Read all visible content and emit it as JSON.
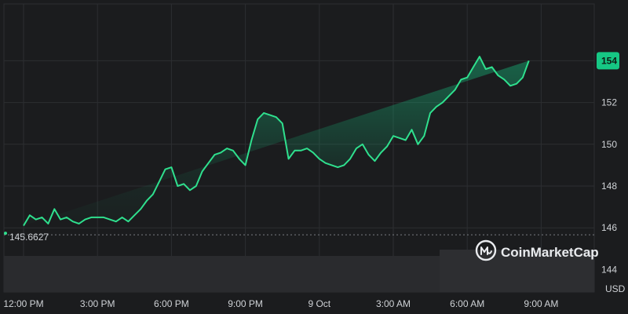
{
  "chart_data": {
    "type": "area",
    "title": "",
    "xlabel": "",
    "ylabel": "USD",
    "ylim": [
      143,
      155.5
    ],
    "grid": true,
    "legend": "none",
    "x_tick_labels": [
      "12:00 PM",
      "3:00 PM",
      "6:00 PM",
      "9:00 PM",
      "9 Oct",
      "3:00 AM",
      "6:00 AM",
      "9:00 AM"
    ],
    "y_tick_labels": [
      "144",
      "146",
      "148",
      "150",
      "152",
      "154"
    ],
    "y_unit": "USD",
    "reference_line": {
      "value": 145.6627,
      "label": "145.6627"
    },
    "current_value": {
      "value": 154,
      "label": "154"
    },
    "x_hours": [
      0,
      0.25,
      0.5,
      0.75,
      1,
      1.25,
      1.5,
      1.75,
      2,
      2.25,
      2.5,
      2.75,
      3,
      3.25,
      3.5,
      3.75,
      4,
      4.25,
      4.5,
      4.75,
      5,
      5.25,
      5.5,
      5.75,
      6,
      6.25,
      6.5,
      6.75,
      7,
      7.25,
      7.5,
      7.75,
      8,
      8.25,
      8.5,
      8.75,
      9,
      9.25,
      9.5,
      9.75,
      10,
      10.25,
      10.5,
      10.75,
      11,
      11.25,
      11.5,
      11.75,
      12,
      12.25,
      12.5,
      12.75,
      13,
      13.25,
      13.5,
      13.75,
      14,
      14.25,
      14.5,
      14.75,
      15,
      15.25,
      15.5,
      15.75,
      16,
      16.25,
      16.5,
      16.75,
      17,
      17.25,
      17.5,
      17.75,
      18,
      18.25,
      18.5,
      18.75,
      19,
      19.25,
      19.5,
      19.75,
      20,
      20.25,
      20.5,
      20.75,
      21,
      21.25,
      21.5,
      21.75,
      22,
      22.25,
      22.5,
      22.75,
      23,
      23.25,
      23.5
    ],
    "values": [
      146.1,
      146.6,
      146.4,
      146.5,
      146.2,
      146.9,
      146.4,
      146.5,
      146.3,
      146.2,
      146.4,
      146.5,
      146.5,
      146.5,
      146.4,
      146.3,
      146.5,
      146.3,
      146.6,
      146.9,
      147.3,
      147.6,
      148.2,
      148.8,
      148.9,
      148.0,
      148.1,
      147.8,
      148.0,
      148.7,
      149.1,
      149.5,
      149.6,
      149.8,
      149.7,
      149.3,
      149.0,
      150.2,
      151.2,
      151.5,
      151.4,
      151.3,
      151.0,
      149.3,
      149.7,
      149.7,
      149.8,
      149.6,
      149.3,
      149.1,
      149.0,
      148.9,
      149.0,
      149.3,
      149.8,
      150.0,
      149.5,
      149.2,
      149.6,
      149.9,
      150.4,
      150.3,
      150.2,
      150.7,
      150.0,
      150.4,
      151.5,
      151.8,
      152.0,
      152.3,
      152.6,
      153.1,
      153.2,
      153.7,
      154.2,
      153.6,
      153.7,
      153.3,
      153.1,
      152.8,
      152.9,
      153.2,
      154.0
    ],
    "source_logo": "CoinMarketCap"
  }
}
